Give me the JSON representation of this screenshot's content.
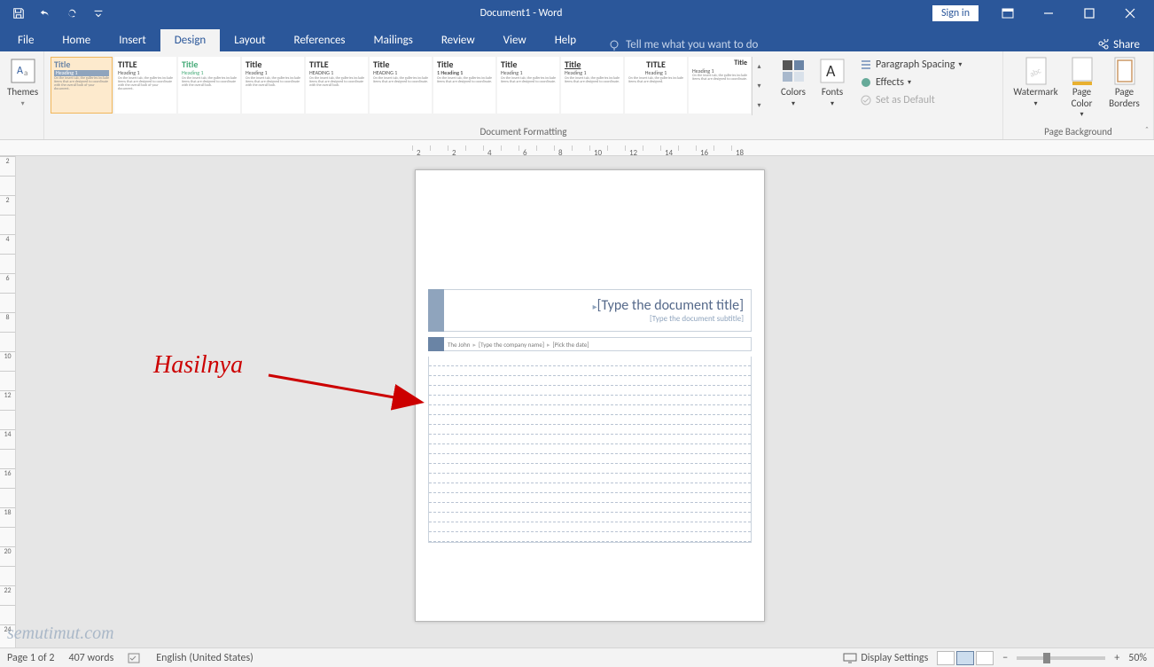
{
  "titlebar": {
    "title": "Document1 - Word",
    "signin": "Sign in"
  },
  "tabs": {
    "file": "File",
    "home": "Home",
    "insert": "Insert",
    "design": "Design",
    "layout": "Layout",
    "references": "References",
    "mailings": "Mailings",
    "review": "Review",
    "view": "View",
    "help": "Help",
    "tellme": "Tell me what you want to do",
    "share": "Share"
  },
  "ribbon": {
    "themes": "Themes",
    "colors": "Colors",
    "fonts": "Fonts",
    "paragraph_spacing": "Paragraph Spacing",
    "effects": "Effects",
    "set_default": "Set as Default",
    "watermark": "Watermark",
    "page_color": "Page Color",
    "page_borders": "Page Borders",
    "doc_formatting": "Document Formatting",
    "page_background": "Page Background",
    "styles": [
      {
        "title": "Title",
        "heading": "Heading 1"
      },
      {
        "title": "TITLE",
        "heading": "Heading 1"
      },
      {
        "title": "Title",
        "heading": "Heading 1"
      },
      {
        "title": "Title",
        "heading": "Heading 1"
      },
      {
        "title": "TITLE",
        "heading": "HEADING 1"
      },
      {
        "title": "Title",
        "heading": "HEADING 1"
      },
      {
        "title": "Title",
        "heading": "1 Heading 1"
      },
      {
        "title": "Title",
        "heading": "Heading 1"
      },
      {
        "title": "Title",
        "heading": "Heading 1"
      },
      {
        "title": "TITLE",
        "heading": "Heading 1"
      },
      {
        "title": "Title",
        "heading": "Heading 1"
      }
    ]
  },
  "ruler": {
    "h": [
      "2",
      "",
      "2",
      "",
      "4",
      "",
      "6",
      "",
      "8",
      "",
      "10",
      "",
      "12",
      "",
      "14",
      "",
      "16",
      "",
      "18"
    ],
    "v": [
      "2",
      "",
      "2",
      "",
      "4",
      "",
      "6",
      "",
      "8",
      "",
      "10",
      "",
      "12",
      "",
      "14",
      "",
      "16",
      "",
      "18",
      "",
      "20",
      "",
      "22",
      "",
      "24"
    ]
  },
  "document": {
    "title_placeholder": "[Type the document title]",
    "subtitle_placeholder": "[Type the document subtitle]",
    "author": "The John",
    "company_placeholder": "[Type the company name]",
    "date_placeholder": "[Pick the date]"
  },
  "annotation": {
    "label": "Hasilnya"
  },
  "watermark": "semutimut.com",
  "status": {
    "page": "Page 1 of 2",
    "words": "407 words",
    "lang": "English (United States)",
    "display": "Display Settings",
    "zoom": "50%"
  }
}
